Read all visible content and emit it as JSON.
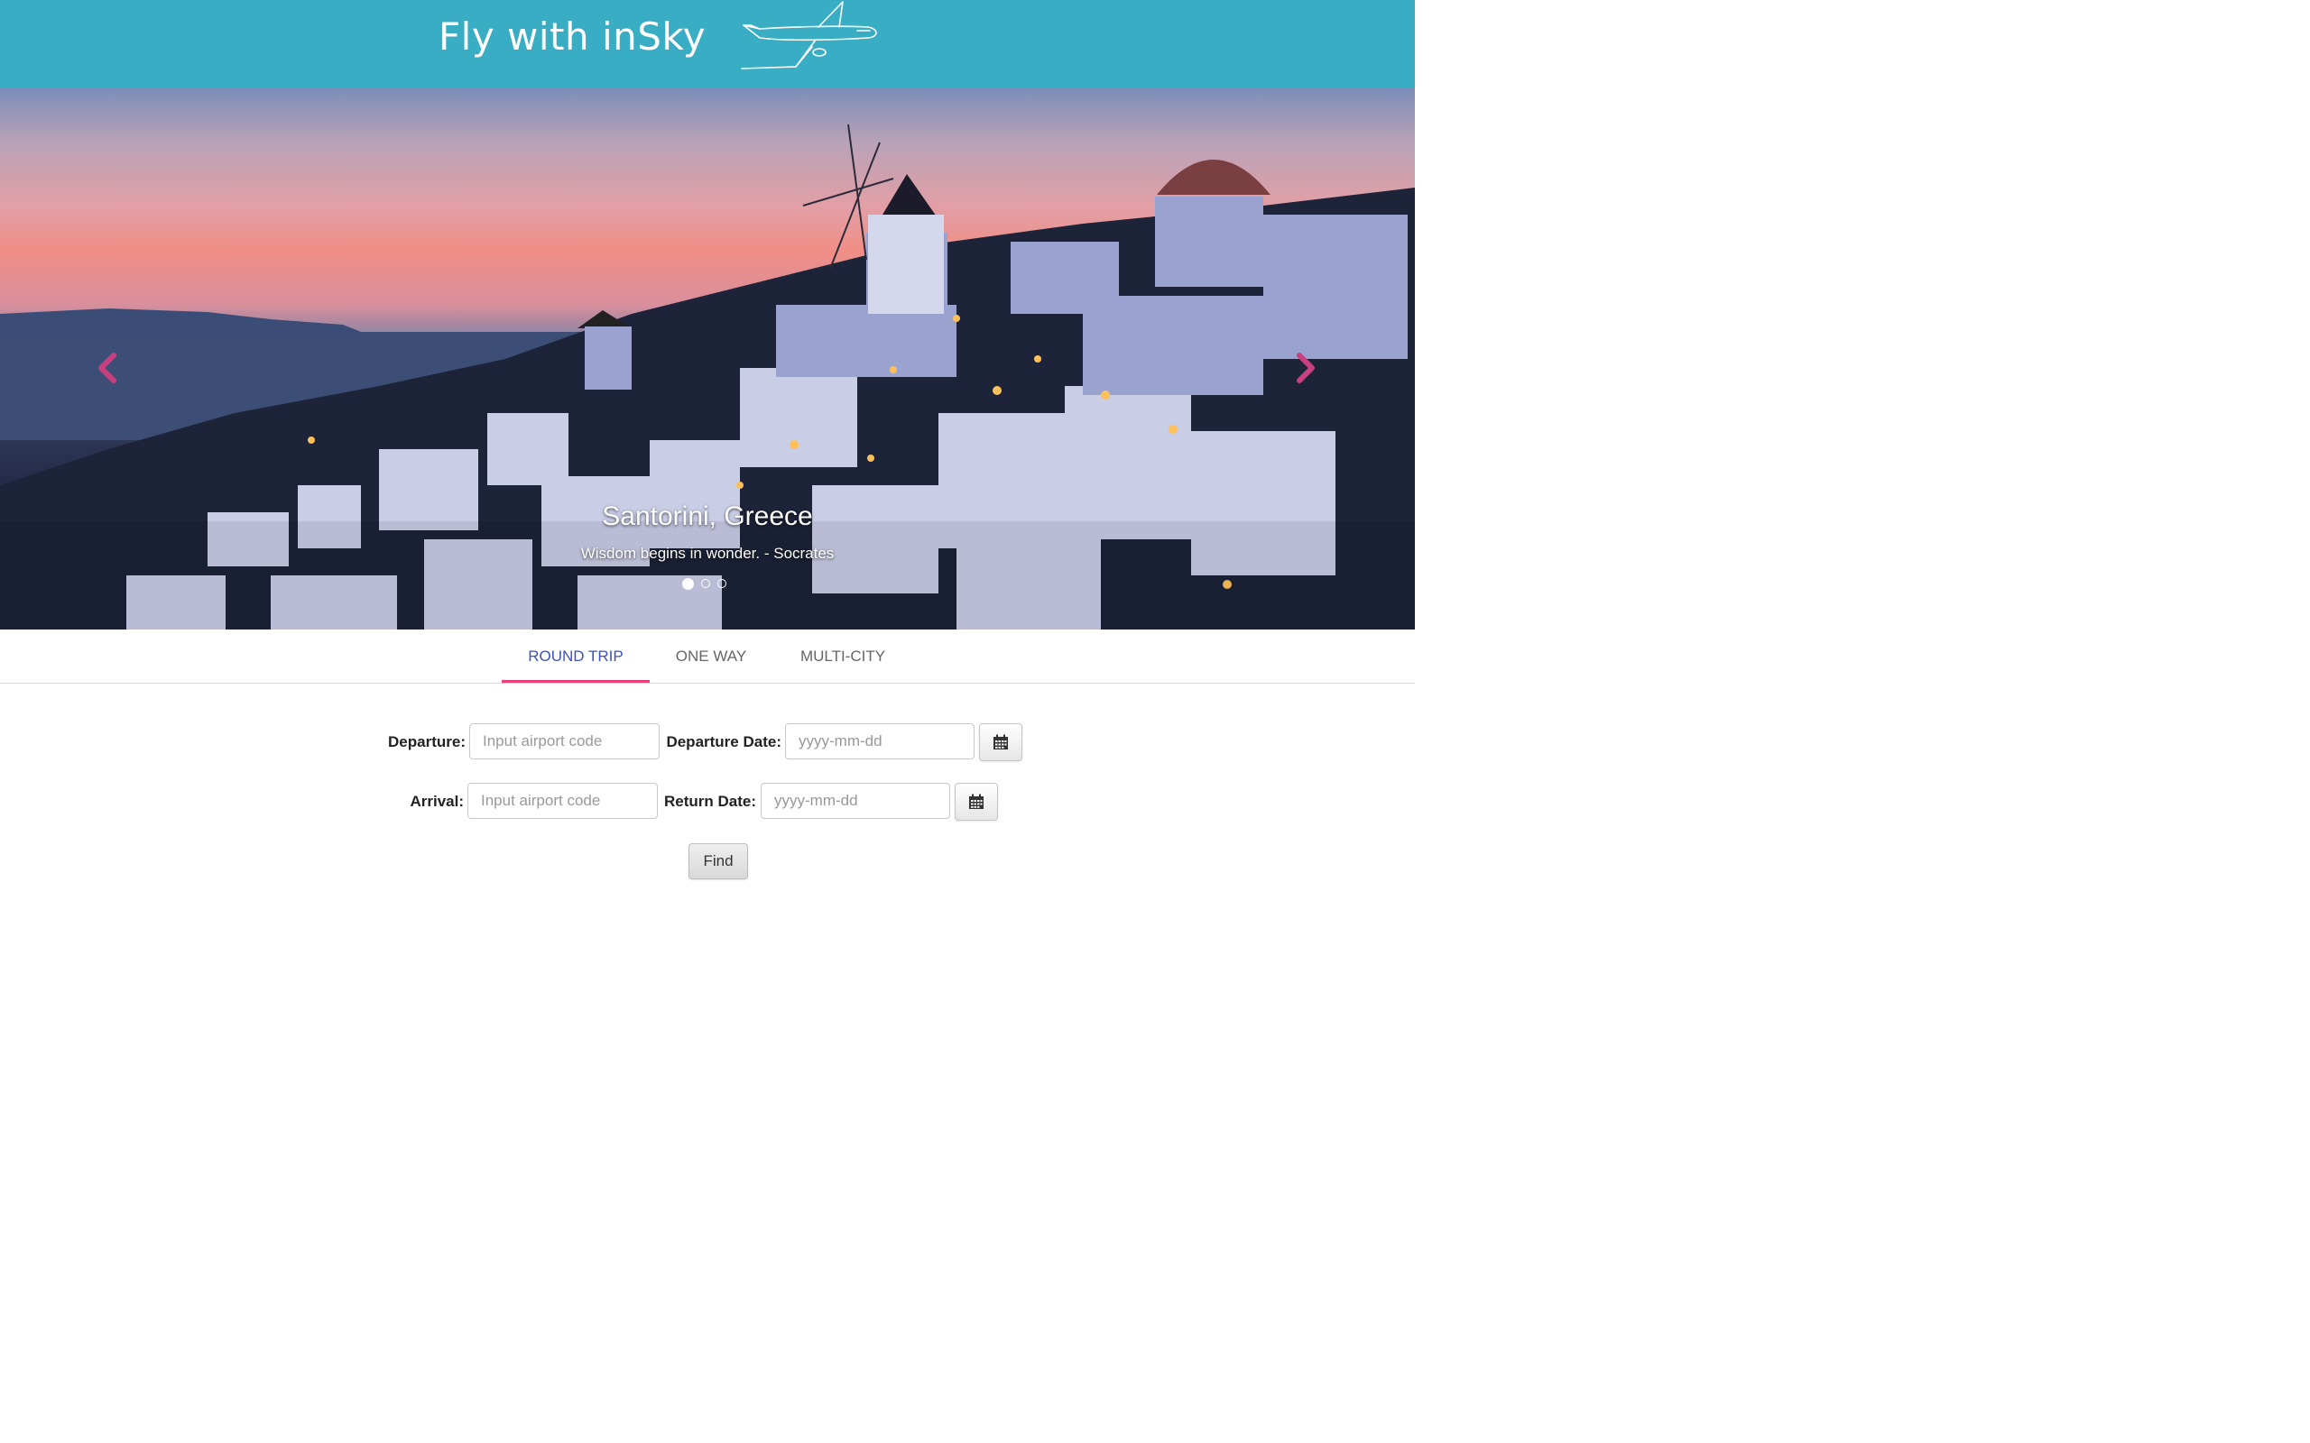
{
  "header": {
    "title": "Fly with inSky"
  },
  "carousel": {
    "caption_title": "Santorini, Greece",
    "caption_text": "Wisdom begins in wonder. - Socrates",
    "slide_count": 3,
    "active_slide": 1,
    "arrow_color": "#c8407f"
  },
  "tabs": [
    {
      "label": "ROUND TRIP",
      "active": true
    },
    {
      "label": "ONE WAY",
      "active": false
    },
    {
      "label": "MULTI-CITY",
      "active": false
    }
  ],
  "form": {
    "departure_label": "Departure:",
    "departure_placeholder": "Input airport code",
    "departure_date_label": "Departure Date:",
    "departure_date_placeholder": "yyyy-mm-dd",
    "arrival_label": "Arrival:",
    "arrival_placeholder": "Input airport code",
    "return_date_label": "Return Date:",
    "return_date_placeholder": "yyyy-mm-dd",
    "find_label": "Find"
  },
  "colors": {
    "header_bg": "#38adc4",
    "active_tab_text": "#3f51b5",
    "active_tab_underline": "#e83e7a"
  }
}
